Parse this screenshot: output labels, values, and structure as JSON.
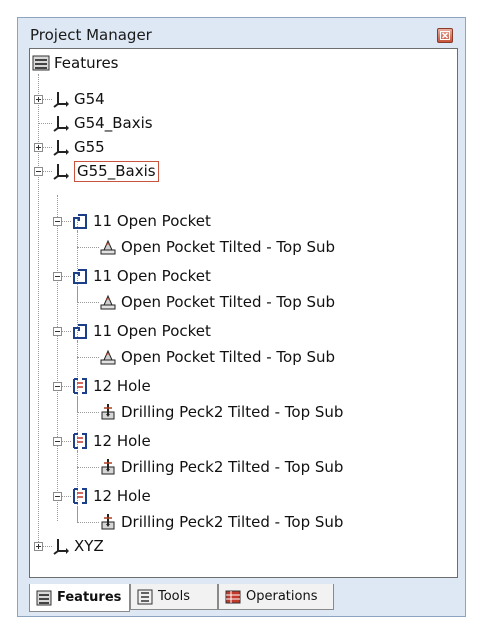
{
  "window": {
    "title": "Project Manager",
    "close_icon": "close-icon"
  },
  "tree": {
    "root_label": "Features",
    "items": [
      {
        "label": "G54"
      },
      {
        "label": "G54_Baxis"
      },
      {
        "label": "G55"
      },
      {
        "label": "G55_Baxis"
      },
      {
        "label": "11 Open Pocket"
      },
      {
        "label": "Open Pocket Tilted - Top Sub"
      },
      {
        "label": "11 Open Pocket"
      },
      {
        "label": "Open Pocket Tilted - Top Sub"
      },
      {
        "label": "11 Open Pocket"
      },
      {
        "label": "Open Pocket Tilted - Top Sub"
      },
      {
        "label": "12 Hole"
      },
      {
        "label": "Drilling Peck2 Tilted - Top Sub"
      },
      {
        "label": "12 Hole"
      },
      {
        "label": "Drilling Peck2 Tilted - Top Sub"
      },
      {
        "label": "12 Hole"
      },
      {
        "label": "Drilling Peck2 Tilted - Top Sub"
      },
      {
        "label": "XYZ"
      }
    ]
  },
  "tabs": [
    {
      "label": "Features",
      "active": true
    },
    {
      "label": "Tools",
      "active": false
    },
    {
      "label": "Operations",
      "active": false
    }
  ],
  "colors": {
    "panel": "#dde8f4",
    "selection_border": "#c9533d",
    "close_button": "#c5523a"
  }
}
